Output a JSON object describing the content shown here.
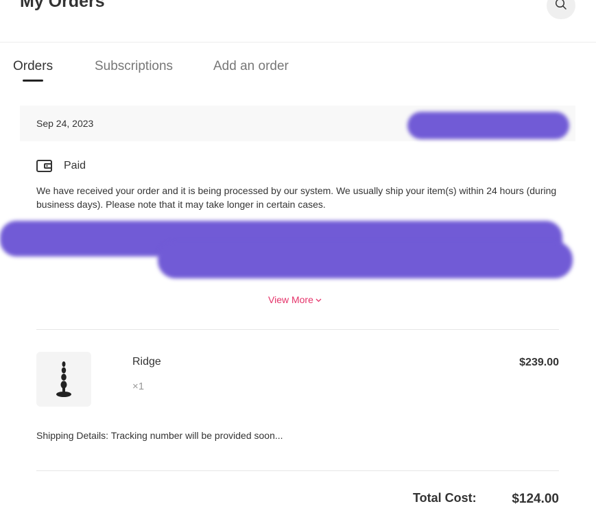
{
  "header": {
    "title": "My Orders",
    "search_icon": "search-icon"
  },
  "tabs": [
    {
      "label": "Orders",
      "active": true
    },
    {
      "label": "Subscriptions",
      "active": false
    },
    {
      "label": "Add an order",
      "active": false
    }
  ],
  "order": {
    "date": "Sep 24, 2023",
    "status": {
      "icon": "wallet-icon",
      "label": "Paid",
      "message": "We have received your order and it is being processed by our system. We usually ship your item(s) within 24 hours (during business days). Please note that it may take longer in certain cases."
    },
    "view_more": "View More",
    "item": {
      "name": "Ridge",
      "quantity": "×1",
      "price": "$239.00"
    },
    "shipping_details": "Shipping Details: Tracking number will be provided soon...",
    "total_label": "Total Cost:",
    "total_value": "$124.00"
  },
  "colors": {
    "accent": "#e5336a",
    "redaction": "#715bd6",
    "bar_bg": "#f8f8f8"
  }
}
